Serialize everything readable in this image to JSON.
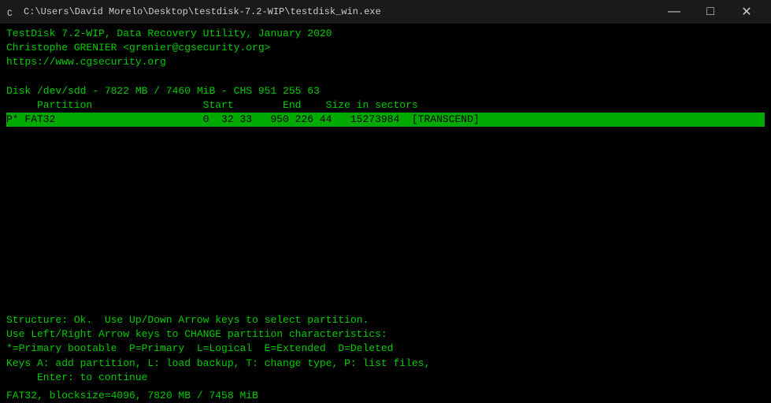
{
  "titlebar": {
    "icon": "C",
    "path": "C:\\Users\\David Morelo\\Desktop\\testdisk-7.2-WIP\\testdisk_win.exe",
    "minimize": "—",
    "maximize": "□",
    "close": "✕"
  },
  "terminal": {
    "line1": "TestDisk 7.2-WIP, Data Recovery Utility, January 2020",
    "line2": "Christophe GRENIER <grenier@cgsecurity.org>",
    "line3": "https://www.cgsecurity.org",
    "line4": "",
    "line5": "Disk /dev/sdd - 7822 MB / 7460 MiB - CHS 951 255 63",
    "col_header": "     Partition                  Start        End    Size in sectors",
    "partition_row": "P* FAT32                        0  32 33   950 226 44   15273984  [TRANSCEND]",
    "status1": "Structure: Ok.  Use Up/Down Arrow keys to select partition.",
    "status2": "Use Left/Right Arrow keys to CHANGE partition characteristics:",
    "status3": "*=Primary bootable  P=Primary  L=Logical  E=Extended  D=Deleted",
    "status4": "Keys A: add partition, L: load backup, T: change type, P: list files,",
    "status5": "     Enter: to continue",
    "bottombar": "FAT32, blocksize=4096, 7820 MB / 7458 MiB"
  }
}
